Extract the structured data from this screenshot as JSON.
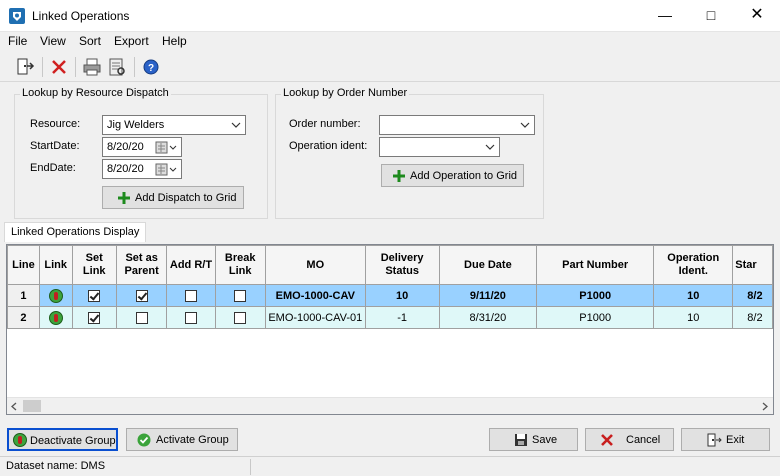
{
  "window": {
    "title": "Linked Operations"
  },
  "menu": [
    "File",
    "View",
    "Sort",
    "Export",
    "Help"
  ],
  "toolbar": [
    "exit-icon",
    "delete-icon",
    "print-icon",
    "print-preview-icon",
    "help-icon"
  ],
  "dispatch": {
    "group_title": "Lookup by Resource Dispatch",
    "resource_label": "Resource:",
    "resource_value": "Jig Welders",
    "start_label": "StartDate:",
    "start_value": "8/20/20",
    "end_label": "EndDate:",
    "end_value": "8/20/20",
    "add_button": "Add Dispatch to Grid"
  },
  "order": {
    "group_title": "Lookup by Order Number",
    "order_label": "Order number:",
    "order_value": "",
    "op_label": "Operation ident:",
    "op_value": "",
    "add_button": "Add Operation to Grid"
  },
  "tab_label": "Linked Operations Display",
  "grid": {
    "columns": [
      "Line",
      "Link",
      "Set Link",
      "Set as Parent",
      "Add R/T",
      "Break Link",
      "MO",
      "Delivery Status",
      "Due Date",
      "Part Number",
      "Operation Ident.",
      "Star"
    ],
    "rows": [
      {
        "line": "1",
        "set_link": true,
        "set_parent": true,
        "add_rt": false,
        "break_link": false,
        "mo": "EMO-1000-CAV",
        "delivery": "10",
        "due": "9/11/20",
        "part": "P1000",
        "op": "10",
        "start": "8/2"
      },
      {
        "line": "2",
        "set_link": true,
        "set_parent": false,
        "add_rt": false,
        "break_link": false,
        "mo": "EMO-1000-CAV-01",
        "delivery": "-1",
        "due": "8/31/20",
        "part": "P1000",
        "op": "10",
        "start": "8/2"
      }
    ]
  },
  "buttons": {
    "deactivate": "Deactivate Group",
    "activate": "Activate Group",
    "save": "Save",
    "cancel": "Cancel",
    "exit": "Exit"
  },
  "status": {
    "dataset": "Dataset name:  DMS"
  }
}
